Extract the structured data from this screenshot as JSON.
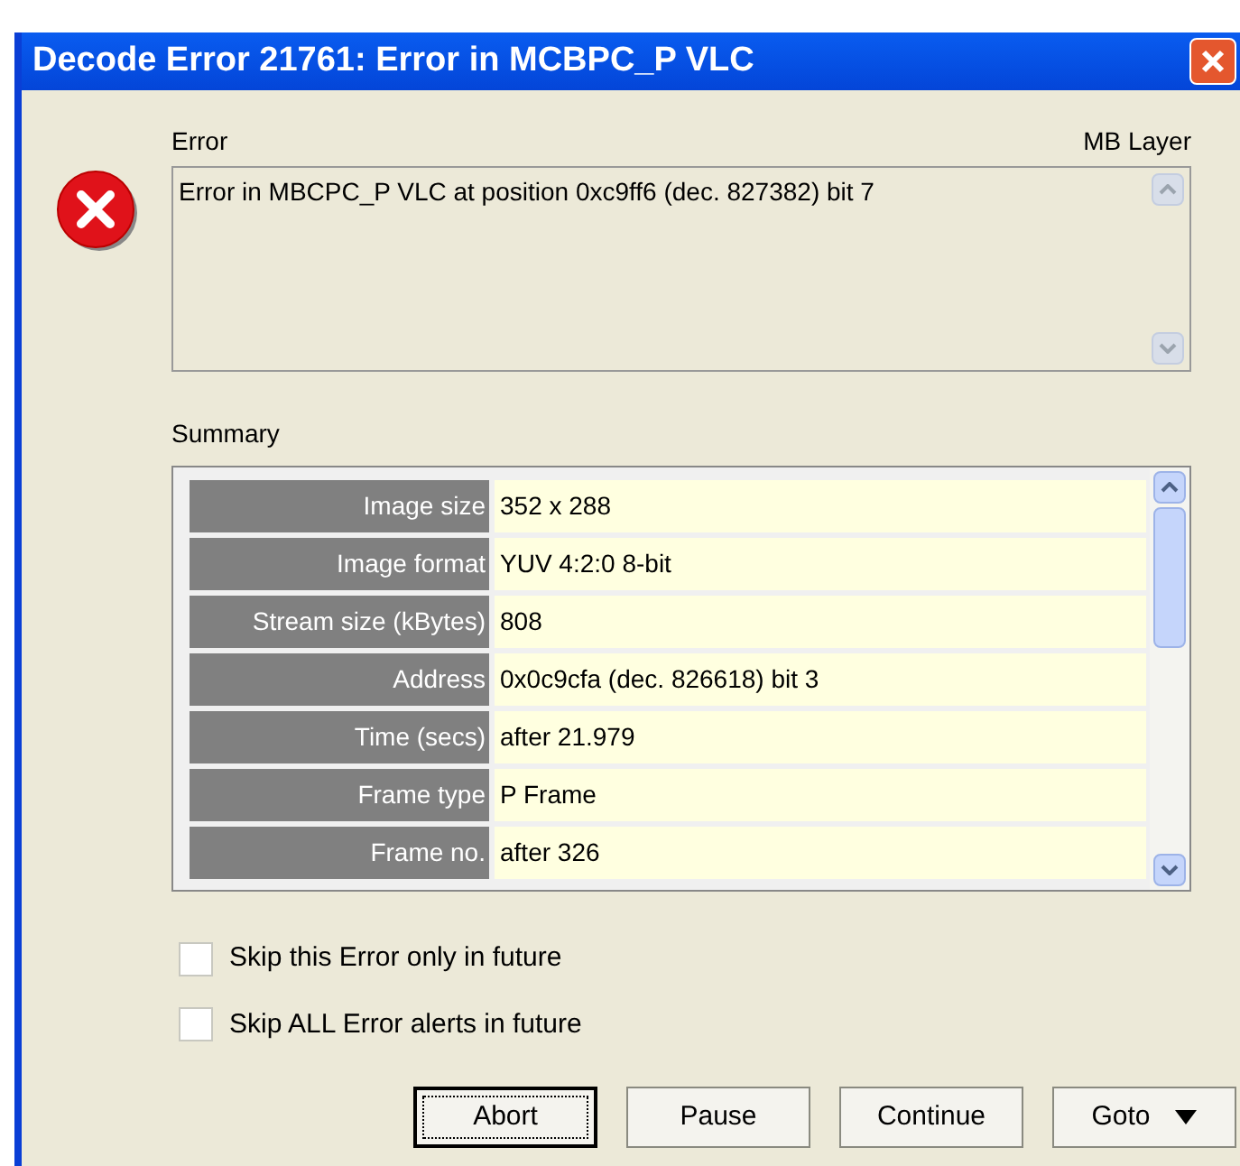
{
  "window": {
    "title": "Decode Error 21761: Error in MCBPC_P VLC"
  },
  "error": {
    "label": "Error",
    "layer": "MB Layer",
    "message": "Error in MBCPC_P VLC at position 0xc9ff6 (dec. 827382) bit 7"
  },
  "summary": {
    "label": "Summary",
    "rows": [
      {
        "name": "Image size",
        "value": "352 x 288"
      },
      {
        "name": "Image format",
        "value": "YUV 4:2:0 8-bit"
      },
      {
        "name": "Stream size (kBytes)",
        "value": "808"
      },
      {
        "name": "Address",
        "value": "0x0c9cfa (dec. 826618) bit 3"
      },
      {
        "name": "Time (secs)",
        "value": "after 21.979"
      },
      {
        "name": "Frame type",
        "value": "P Frame"
      },
      {
        "name": "Frame no.",
        "value": "after 326"
      }
    ]
  },
  "options": [
    {
      "label": "Skip this Error only in future",
      "checked": false
    },
    {
      "label": "Skip ALL Error alerts in future",
      "checked": false
    }
  ],
  "buttons": [
    {
      "label": "Abort",
      "focused": true,
      "kind": "plain"
    },
    {
      "label": "Pause",
      "focused": false,
      "kind": "plain"
    },
    {
      "label": "Continue",
      "focused": false,
      "kind": "plain"
    },
    {
      "label": "Goto",
      "focused": false,
      "kind": "menu"
    }
  ]
}
